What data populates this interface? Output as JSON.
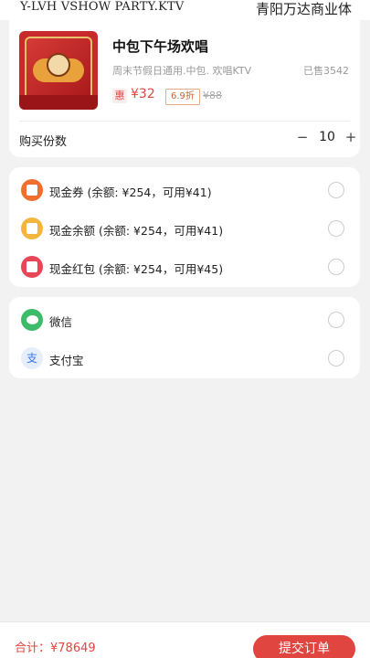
{
  "header": {
    "venue_en": "Y-LVH VSHOW PARTY.KTV",
    "venue_cn": "青阳万达商业体"
  },
  "product": {
    "title": "中包下午场欢唱",
    "description": "周末节假日通用.中包. 欢唱KTV",
    "sold": "已售3542",
    "hui_tag": "惠",
    "price": "¥32",
    "discount": "6.9折",
    "original_price": "¥88"
  },
  "quantity": {
    "label": "购买份数",
    "minus": "−",
    "value": "10",
    "plus": "+"
  },
  "wallet": {
    "items": [
      {
        "label": "现金券 (余额: ¥254，可用¥41)",
        "icon": "coupon-icon",
        "color": "#ef6f2f"
      },
      {
        "label": "现金余额 (余额: ¥254，可用¥41)",
        "icon": "wallet-icon",
        "color": "#f2b63f"
      },
      {
        "label": "现金红包 (余额: ¥254，可用¥45)",
        "icon": "red-packet-icon",
        "color": "#e9465a"
      }
    ]
  },
  "payment": {
    "items": [
      {
        "label": "微信",
        "icon": "wechat-icon",
        "color": "#3dbb6a"
      },
      {
        "label": "支付宝",
        "icon": "alipay-icon",
        "glyph": "支",
        "color": "#3a76e8"
      }
    ]
  },
  "footer": {
    "total": "合计：¥78649",
    "submit": "提交订单"
  }
}
